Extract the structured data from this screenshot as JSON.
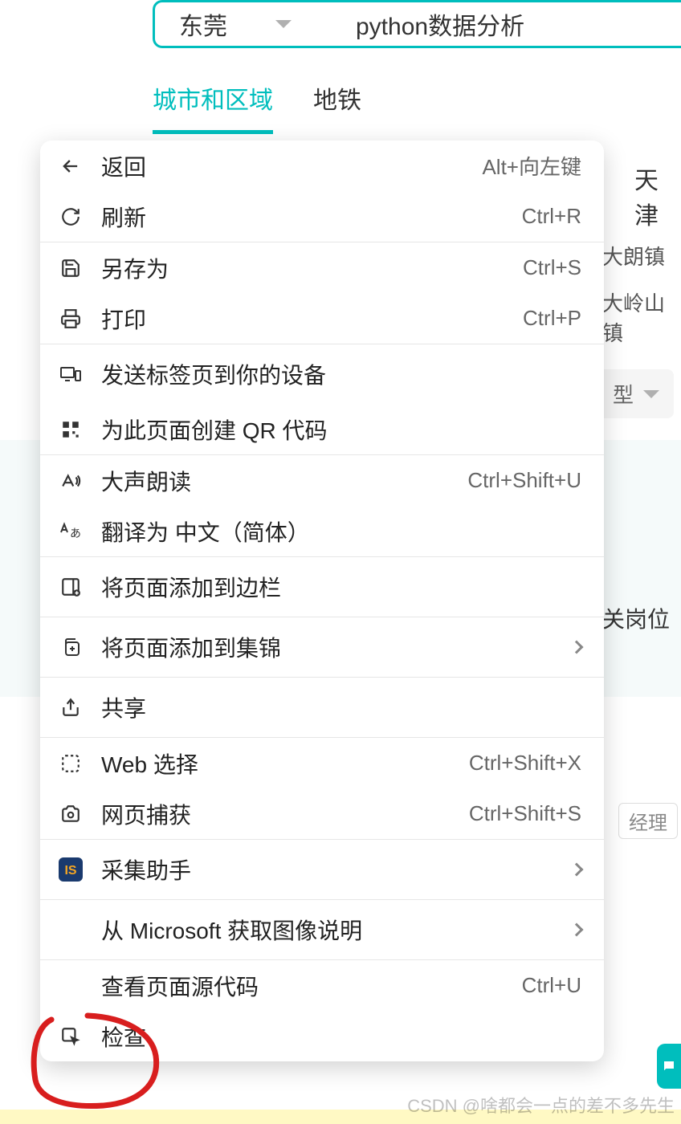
{
  "search": {
    "city": "东莞",
    "term": "python数据分析"
  },
  "tabs": {
    "active": "城市和区域",
    "metro": "地铁"
  },
  "background": {
    "city_partial": "天津",
    "district1": "大朗镇",
    "district2": "大岭山镇",
    "filter_partial": "型",
    "job_text": "关岗位",
    "tag_text": "经理"
  },
  "menu": {
    "back": {
      "label": "返回",
      "shortcut": "Alt+向左键"
    },
    "refresh": {
      "label": "刷新",
      "shortcut": "Ctrl+R"
    },
    "save_as": {
      "label": "另存为",
      "shortcut": "Ctrl+S"
    },
    "print": {
      "label": "打印",
      "shortcut": "Ctrl+P"
    },
    "send_tab": {
      "label": "发送标签页到你的设备"
    },
    "qr": {
      "label": "为此页面创建 QR 代码"
    },
    "read_aloud": {
      "label": "大声朗读",
      "shortcut": "Ctrl+Shift+U"
    },
    "translate": {
      "label": "翻译为 中文（简体）"
    },
    "add_sidebar": {
      "label": "将页面添加到边栏"
    },
    "add_collection": {
      "label": "将页面添加到集锦"
    },
    "share": {
      "label": "共享"
    },
    "web_select": {
      "label": "Web 选择",
      "shortcut": "Ctrl+Shift+X"
    },
    "web_capture": {
      "label": "网页捕获",
      "shortcut": "Ctrl+Shift+S"
    },
    "collector": {
      "label": "采集助手"
    },
    "ms_image": {
      "label": "从 Microsoft 获取图像说明"
    },
    "view_source": {
      "label": "查看页面源代码",
      "shortcut": "Ctrl+U"
    },
    "inspect": {
      "label": "检查"
    }
  },
  "watermark": "CSDN @啥都会一点的差不多先生"
}
